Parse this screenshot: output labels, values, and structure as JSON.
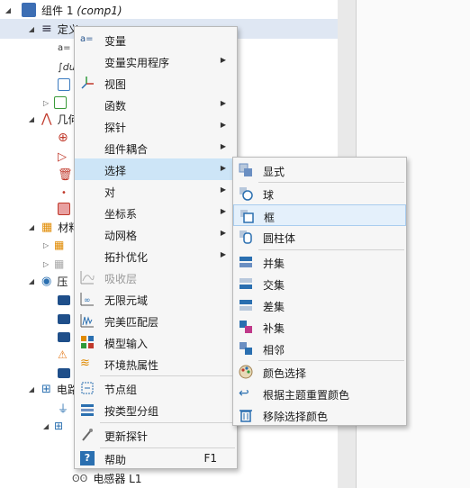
{
  "tree": {
    "rows": [
      {
        "label": "组件 1",
        "italic": "(comp1)"
      },
      {
        "label": "定义"
      },
      {
        "label": "几何"
      },
      {
        "label": "材料"
      },
      {
        "label": "压"
      },
      {
        "label": "电路"
      },
      {
        "label": "电感器 L1"
      }
    ]
  },
  "menu1": {
    "items": [
      {
        "label": "变量",
        "icon": "a=",
        "icon_name": "variable-icon"
      },
      {
        "label": "变量实用程序"
      },
      {
        "label": "视图",
        "icon_name": "view-axes-icon"
      },
      {
        "label": "函数"
      },
      {
        "label": "探针"
      },
      {
        "label": "组件耦合"
      },
      {
        "label": "选择"
      },
      {
        "label": "对"
      },
      {
        "label": "坐标系"
      },
      {
        "label": "动网格"
      },
      {
        "label": "拓扑优化"
      },
      {
        "label": "吸收层",
        "icon_name": "absorbing-layer-icon"
      },
      {
        "label": "无限元域",
        "icon_name": "infinite-element-icon"
      },
      {
        "label": "完美匹配层",
        "icon_name": "pml-icon"
      },
      {
        "label": "模型输入",
        "icon_name": "model-input-icon"
      },
      {
        "label": "环境热属性",
        "icon_name": "ambient-thermal-icon"
      },
      {
        "label": "节点组",
        "icon_name": "node-group-icon"
      },
      {
        "label": "按类型分组",
        "icon_name": "group-by-type-icon"
      },
      {
        "label": "更新探针",
        "icon_name": "update-probe-icon"
      },
      {
        "label": "帮助",
        "shortcut": "F1",
        "icon": "?",
        "icon_name": "help-icon"
      }
    ]
  },
  "menu2": {
    "items": [
      {
        "label": "显式",
        "icon_name": "explicit-selection-icon"
      },
      {
        "label": "球",
        "icon_name": "ball-selection-icon"
      },
      {
        "label": "框",
        "icon_name": "box-selection-icon"
      },
      {
        "label": "圆柱体",
        "icon_name": "cylinder-selection-icon"
      },
      {
        "label": "并集",
        "icon_name": "union-selection-icon"
      },
      {
        "label": "交集",
        "icon_name": "intersection-selection-icon"
      },
      {
        "label": "差集",
        "icon_name": "difference-selection-icon"
      },
      {
        "label": "补集",
        "icon_name": "complement-selection-icon"
      },
      {
        "label": "相邻",
        "icon_name": "adjacent-selection-icon"
      },
      {
        "label": "颜色选择",
        "icon_name": "color-palette-icon"
      },
      {
        "label": "根据主题重置颜色",
        "icon_name": "reset-color-icon"
      },
      {
        "label": "移除选择颜色",
        "icon_name": "trash-icon"
      }
    ]
  },
  "colors": {
    "highlight": "#cde5f7",
    "submenu_highlight": "#e4f0fb",
    "tree_selected": "#dfe7f3"
  }
}
